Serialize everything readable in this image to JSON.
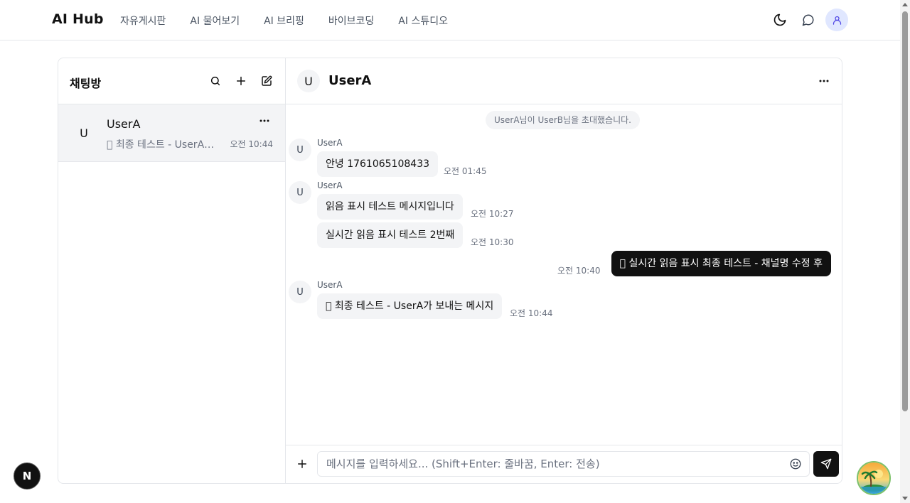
{
  "brand": "AI Hub",
  "nav": {
    "items": [
      {
        "label": "자유게시판"
      },
      {
        "label": "AI 물어보기"
      },
      {
        "label": "AI 브리핑"
      },
      {
        "label": "바이브코딩"
      },
      {
        "label": "AI 스튜디오"
      }
    ]
  },
  "sidebar": {
    "title": "채팅방",
    "rooms": [
      {
        "avatar": "U",
        "name": "UserA",
        "preview": "󰀀 최종 테스트 - UserA가 보내는 메시지",
        "time": "오전 10:44"
      }
    ]
  },
  "chat": {
    "avatar": "U",
    "title": "UserA",
    "system_message": "UserA님이 UserB님을 초대했습니다.",
    "messages": [
      {
        "sender": "UserA",
        "avatar": "U",
        "text": "안녕 1761065108433",
        "time": "오전 01:45"
      },
      {
        "sender": "UserA",
        "avatar": "U",
        "text": "읽음 표시 테스트 메시지입니다",
        "time": "오전 10:27"
      },
      {
        "sender": "",
        "avatar": "",
        "text": "실시간 읽음 표시 테스트 2번째",
        "time": "오전 10:30"
      },
      {
        "sender": "me",
        "avatar": "",
        "text": "󰀀 실시간 읽음 표시 최종 테스트 - 채널명 수정 후",
        "time": "오전 10:40"
      },
      {
        "sender": "UserA",
        "avatar": "U",
        "text": "󰀀 최종 테스트 - UserA가 보내는 메시지",
        "time": "오전 10:44"
      }
    ]
  },
  "composer": {
    "placeholder": "메시지를 입력하세요... (Shift+Enter: 줄바꿈, Enter: 전송)",
    "value": ""
  },
  "badges": {
    "next": "N"
  },
  "colors": {
    "accent": "#111111",
    "bubble_other": "#f3f4f6",
    "avatar_bg": "#e0e7ff",
    "user_icon": "#4f46e5"
  }
}
